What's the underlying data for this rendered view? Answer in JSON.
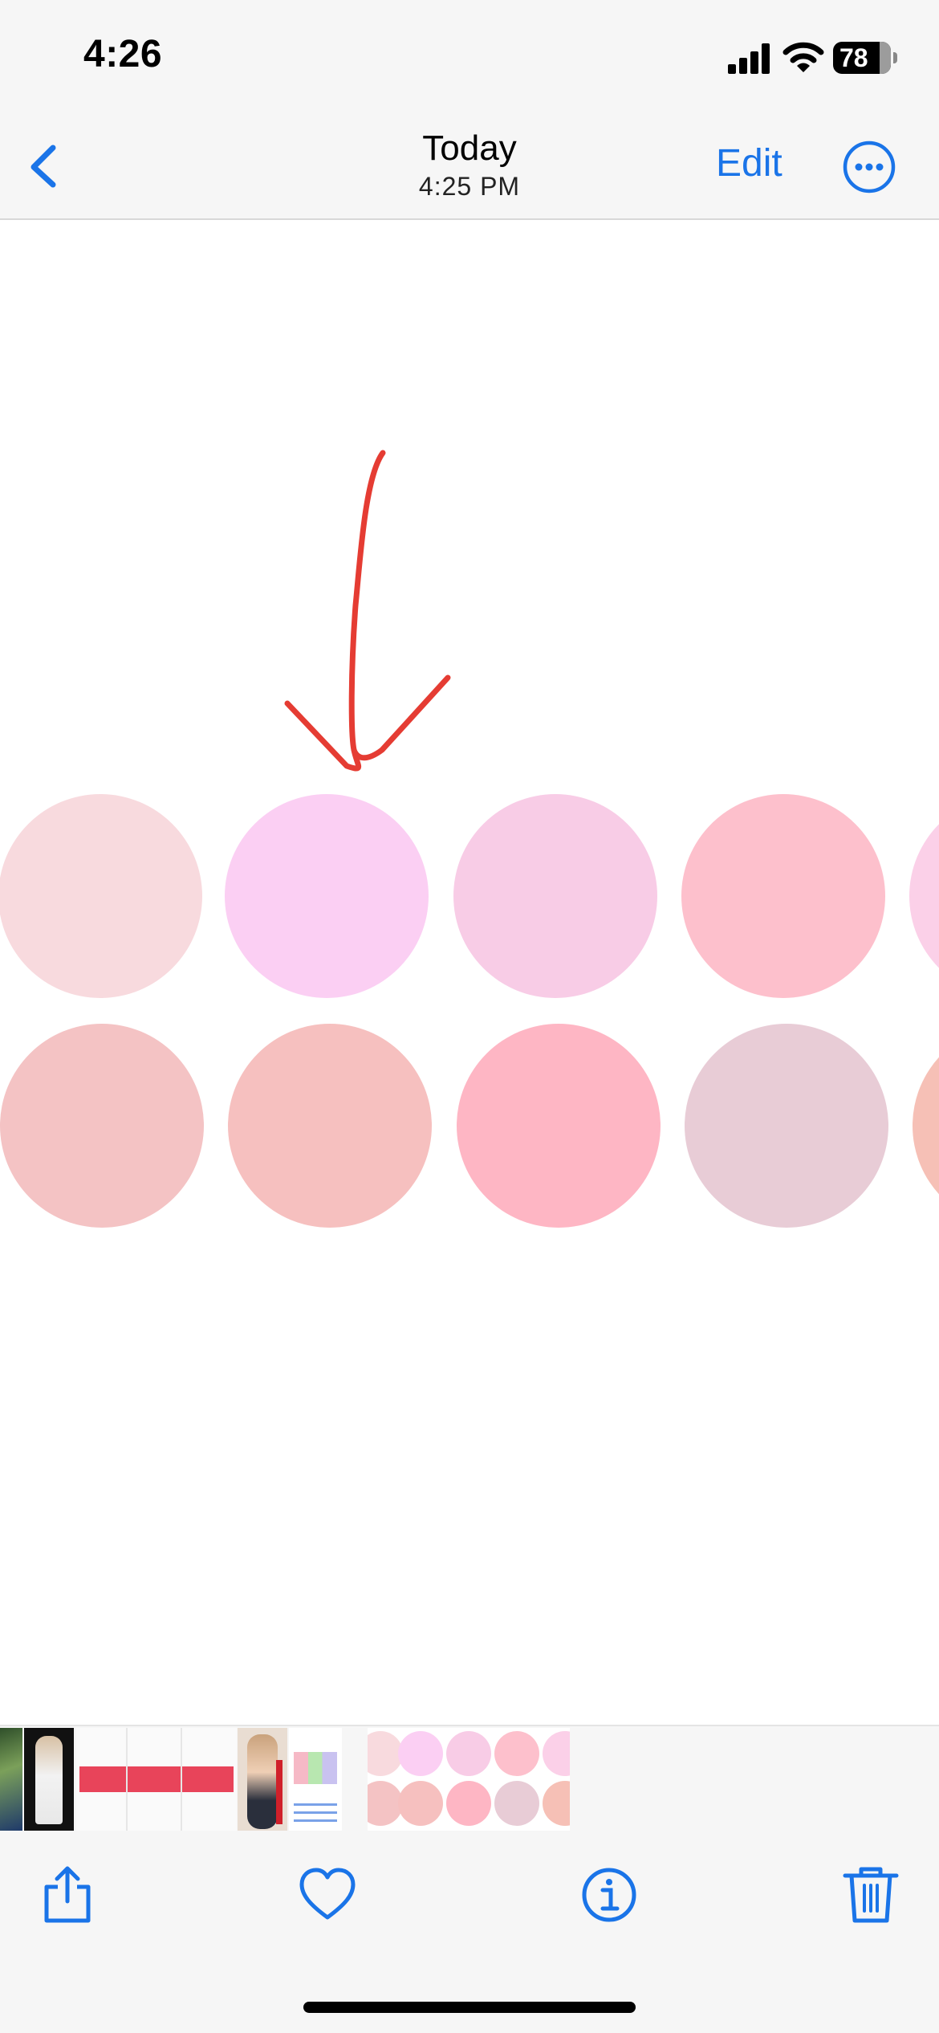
{
  "status_bar": {
    "time": "4:26",
    "battery": "78"
  },
  "nav": {
    "title": "Today",
    "subtitle": "4:25 PM",
    "edit_label": "Edit",
    "back_icon": "chevron-left-icon",
    "more_icon": "ellipsis-circle-icon"
  },
  "swatches": {
    "row1": [
      "#f8dade",
      "#fbcff3",
      "#f8cce6",
      "#fdc0cc",
      "#fbd0e8"
    ],
    "row2": [
      "#f4c3c4",
      "#f6c0bf",
      "#feb6c4",
      "#e8ccd6",
      "#f6c0b6"
    ]
  },
  "annotation": {
    "arrow_color": "#e53c33"
  },
  "toolbar": {
    "share_icon": "share-icon",
    "favorite_icon": "heart-icon",
    "info_icon": "info-icon",
    "delete_icon": "trash-icon"
  },
  "colors": {
    "accent": "#1a74e8"
  }
}
